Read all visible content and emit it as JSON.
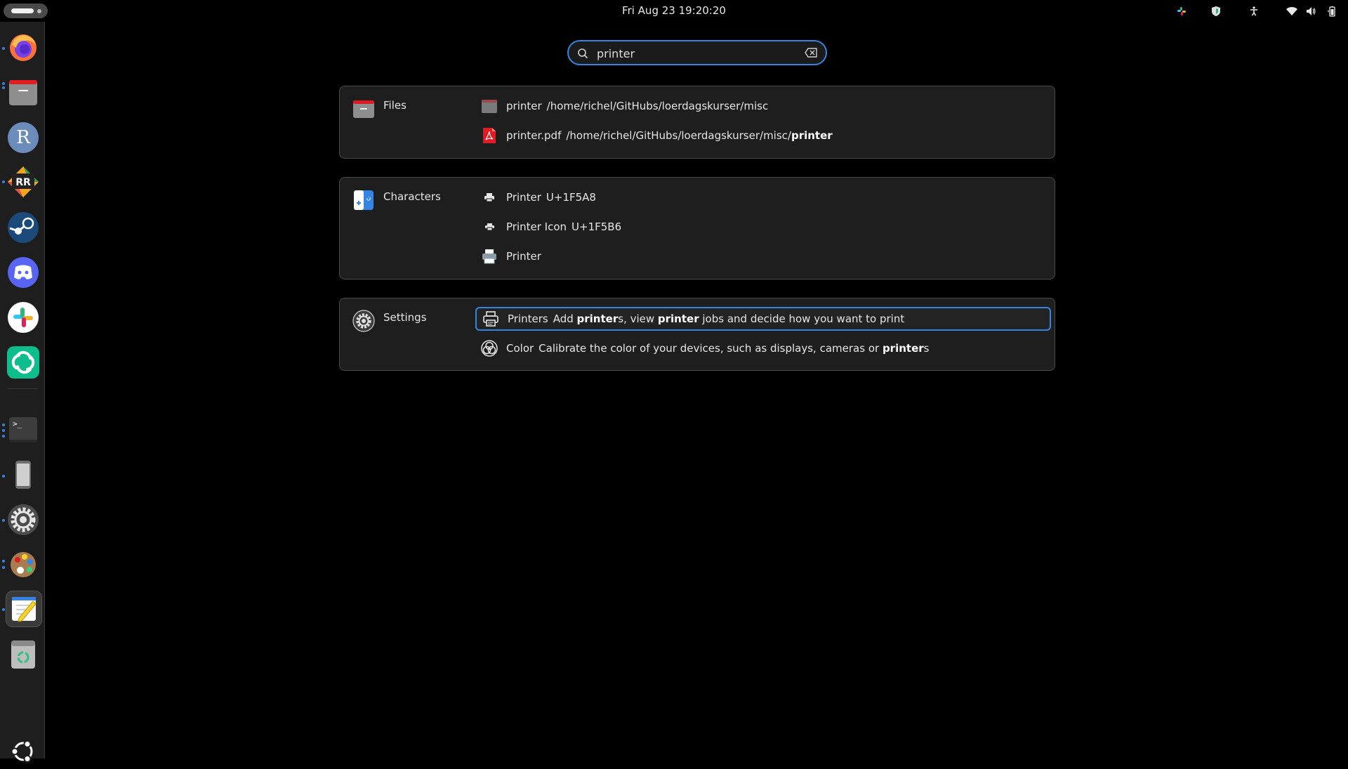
{
  "topbar": {
    "clock": "Fri Aug 23  19:20:20"
  },
  "dock": {
    "apps": [
      {
        "name": "Firefox",
        "icon": "firefox-icon"
      },
      {
        "name": "Files",
        "icon": "folder-icon"
      },
      {
        "name": "R",
        "icon": "r-icon",
        "letter": "R"
      },
      {
        "name": "RStudio",
        "icon": "rstudio-icon",
        "letter": "RR"
      },
      {
        "name": "Steam",
        "icon": "steam-icon"
      },
      {
        "name": "Discord",
        "icon": "discord-icon"
      },
      {
        "name": "Slack",
        "icon": "slack-icon"
      },
      {
        "name": "Element",
        "icon": "element-icon"
      },
      {
        "name": "Terminal",
        "icon": "terminal-icon",
        "prompt": ">_"
      },
      {
        "name": "Device",
        "icon": "phone-icon"
      },
      {
        "name": "Settings",
        "icon": "gear-icon"
      },
      {
        "name": "Paint",
        "icon": "palette-icon"
      },
      {
        "name": "Text Editor",
        "icon": "text-editor-icon"
      },
      {
        "name": "Trash",
        "icon": "trash-icon"
      }
    ]
  },
  "search": {
    "value": "printer"
  },
  "sections": {
    "files": {
      "name": "Files",
      "results": [
        {
          "title": "printer",
          "desc_plain": "/home/richel/GitHubs/loerdagskurser/misc",
          "desc_bold": "",
          "icon": "folder-icon"
        },
        {
          "title": "printer.pdf",
          "desc_plain": "/home/richel/GitHubs/loerdagskurser/misc/",
          "desc_bold": "printer",
          "icon": "pdf-icon"
        }
      ]
    },
    "characters": {
      "name": "Characters",
      "results": [
        {
          "title": "Printer",
          "desc": "U+1F5A8",
          "icon": "printer-emoji-icon"
        },
        {
          "title": "Printer Icon",
          "desc": "U+1F5B6",
          "icon": "printer-small-icon"
        },
        {
          "title": "Printer",
          "desc": "",
          "icon": "printer-color-icon"
        }
      ]
    },
    "settings": {
      "name": "Settings",
      "results": [
        {
          "title": "Printers",
          "parts": [
            "Add ",
            "printer",
            "s, view ",
            "printer",
            " jobs and decide how you want to print"
          ],
          "icon": "printer-outline-icon",
          "selected": true
        },
        {
          "title": "Color",
          "parts": [
            "Calibrate the color of your devices, such as displays, cameras or ",
            "printer",
            "s"
          ],
          "icon": "color-icon",
          "selected": false
        }
      ]
    }
  },
  "colors": {
    "accent": "#3584e4",
    "panel": "#1e1e1e",
    "dock": "#1e1e1e"
  }
}
